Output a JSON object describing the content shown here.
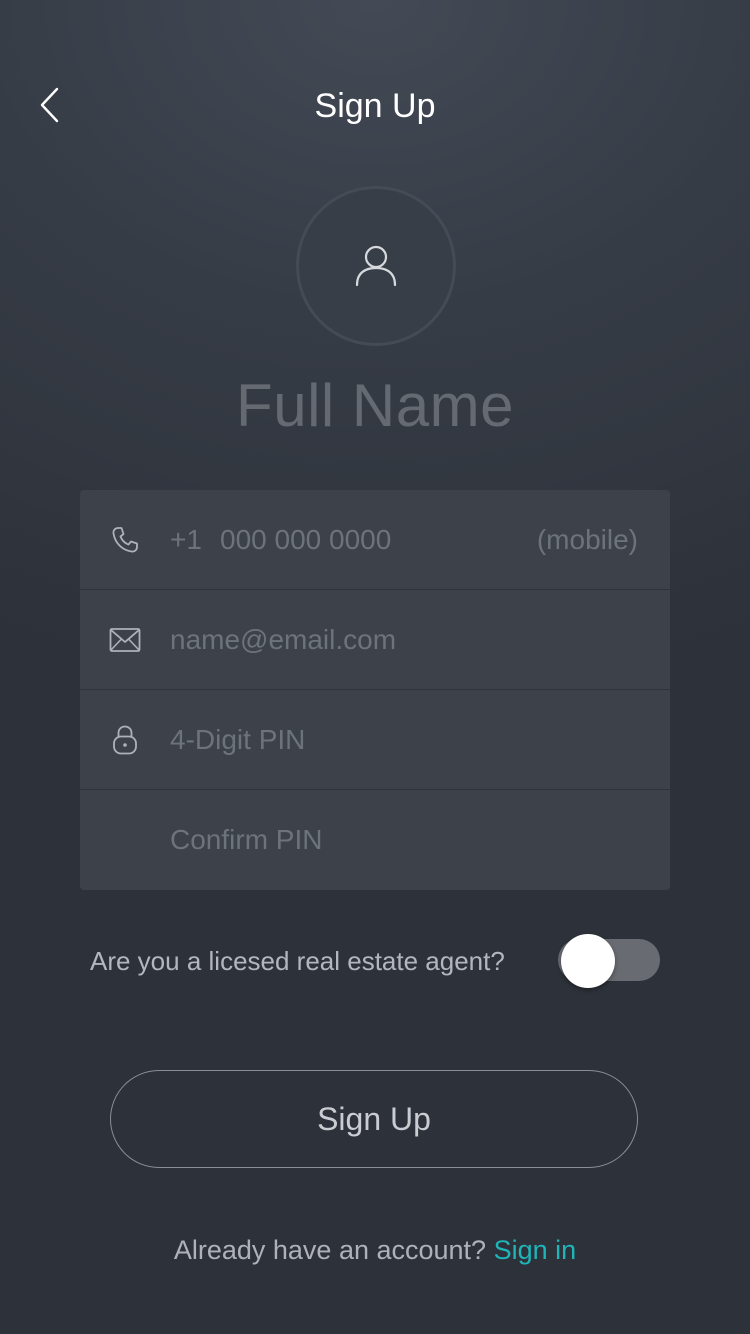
{
  "header": {
    "title": "Sign Up",
    "back_icon": "chevron-left-icon"
  },
  "profile": {
    "avatar_icon": "user-icon",
    "name_placeholder": "Full Name"
  },
  "form": {
    "phone": {
      "icon": "phone-icon",
      "country_code": "+1",
      "placeholder": "000 000 0000",
      "suffix": "(mobile)"
    },
    "email": {
      "icon": "envelope-icon",
      "placeholder": "name@email.com"
    },
    "pin": {
      "icon": "lock-icon",
      "placeholder": "4-Digit PIN"
    },
    "confirm_pin": {
      "placeholder": "Confirm PIN"
    }
  },
  "agent": {
    "question": "Are you a licesed real estate agent?",
    "toggle_on": false
  },
  "actions": {
    "signup_label": "Sign Up"
  },
  "footer": {
    "prompt": "Already have an account?",
    "link": "Sign in"
  },
  "colors": {
    "background": "#363c46",
    "form_bg": "#3c414a",
    "accent": "#1fb5b8",
    "placeholder": "#6d737b",
    "toggle_track": "#686c72"
  }
}
